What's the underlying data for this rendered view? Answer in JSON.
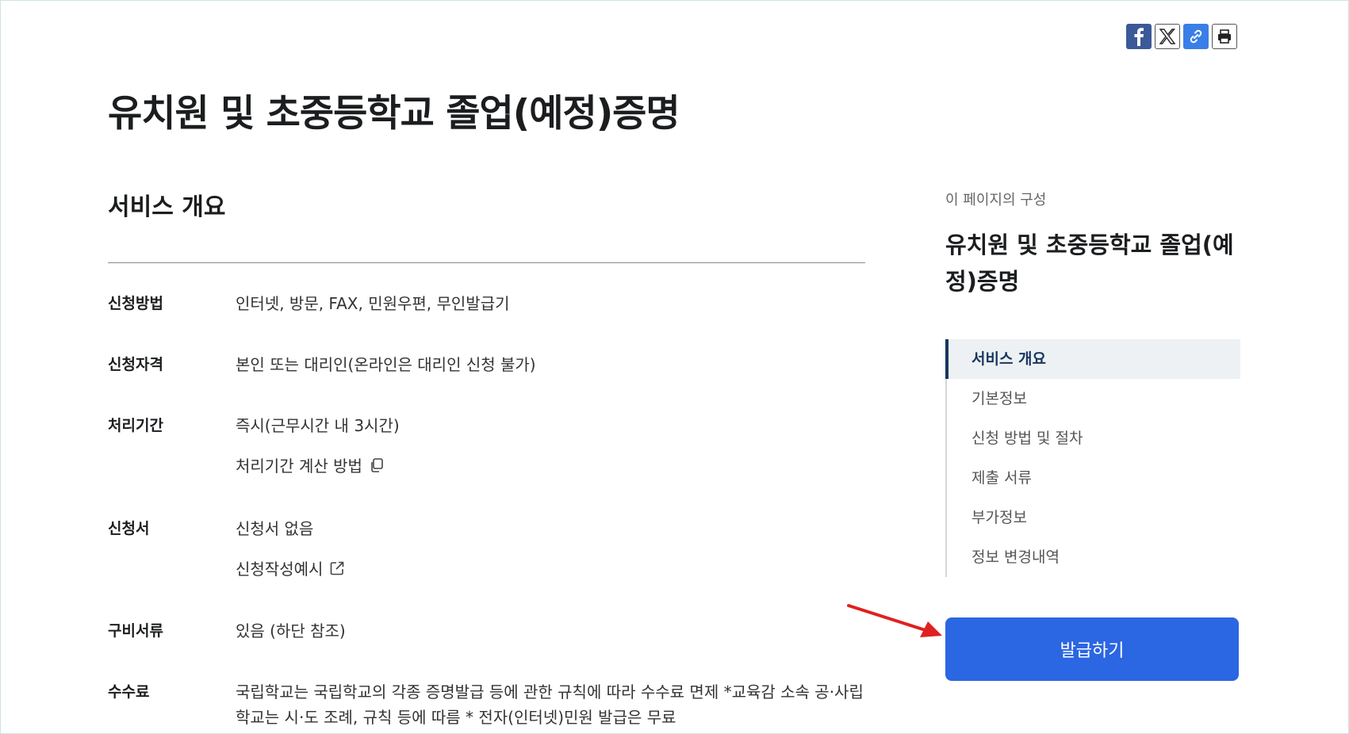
{
  "page": {
    "title": "유치원 및 초중등학교 졸업(예정)증명"
  },
  "overview": {
    "heading": "서비스 개요",
    "rows": [
      {
        "label": "신청방법",
        "value": "인터넷, 방문, FAX, 민원우편, 무인발급기"
      },
      {
        "label": "신청자격",
        "value": "본인 또는 대리인(온라인은 대리인 신청 불가)"
      },
      {
        "label": "처리기간",
        "value": "즉시(근무시간 내 3시간)",
        "link": "처리기간 계산 방법"
      },
      {
        "label": "신청서",
        "value": "신청서 없음",
        "link": "신청작성예시"
      },
      {
        "label": "구비서류",
        "value": "있음 (하단 참조)"
      },
      {
        "label": "수수료",
        "value_line1": "국립학교는 국립학교의 각종 증명발급 등에 관한 규칙에 따라 수수료 면제 *교육감 소속 공·사립",
        "value_line2": "학교는 시·도 조례, 규칙 등에 따름 * 전자(인터넷)민원 발급은 무료"
      }
    ]
  },
  "toc": {
    "caption": "이 페이지의 구성",
    "title": "유치원 및 초중등학교 졸업(예정)증명",
    "items": [
      {
        "label": "서비스 개요",
        "active": true
      },
      {
        "label": "기본정보"
      },
      {
        "label": "신청 방법 및 절차"
      },
      {
        "label": "제출 서류"
      },
      {
        "label": "부가정보"
      },
      {
        "label": "정보 변경내역"
      }
    ]
  },
  "actions": {
    "issue_label": "발급하기"
  },
  "share": {
    "icons": [
      "facebook-icon",
      "x-icon",
      "link-icon",
      "print-icon"
    ]
  },
  "colors": {
    "primary": "#2b66e3",
    "toc_active": "#17365d",
    "arrow": "#e02020"
  }
}
